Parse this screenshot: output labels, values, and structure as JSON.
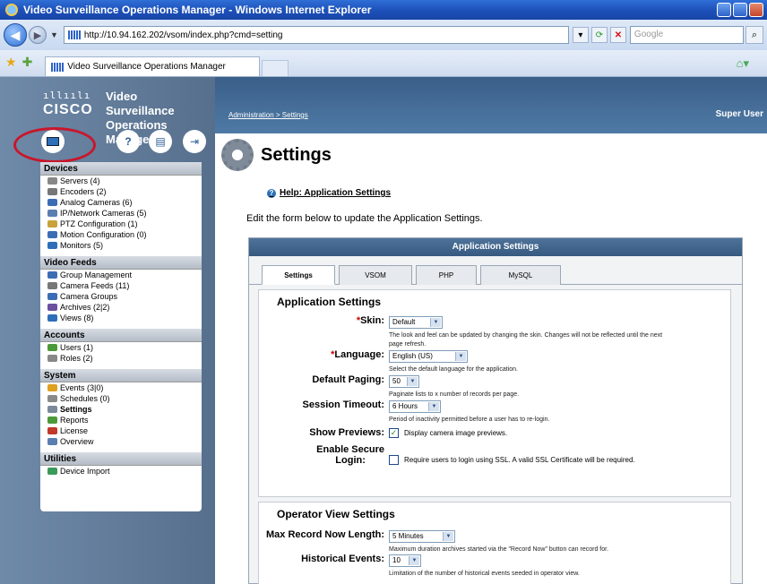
{
  "window": {
    "title": "Video Surveillance Operations Manager - Windows Internet Explorer"
  },
  "browser": {
    "url": "http://10.94.162.202/vsom/index.php?cmd=setting",
    "search_placeholder": "Google",
    "tab_title": "Video Surveillance Operations Manager"
  },
  "brand": {
    "logo_bars": "ıllıılı",
    "logo_word": "CISCO",
    "product_line1": "Video Surveillance",
    "product_line2": "Operations Manager"
  },
  "header": {
    "breadcrumb": "Administration > Settings",
    "user": "Super User"
  },
  "sidebar": {
    "sections": [
      {
        "title": "Devices",
        "items": [
          {
            "label": "Servers (4)",
            "icon": "server-icon",
            "color": "#888888"
          },
          {
            "label": "Encoders (2)",
            "icon": "encoder-icon",
            "color": "#777777"
          },
          {
            "label": "Analog Cameras (6)",
            "icon": "camera-icon",
            "color": "#3b6db5"
          },
          {
            "label": "IP/Network Cameras (5)",
            "icon": "ip-camera-icon",
            "color": "#5a7fb0"
          },
          {
            "label": "PTZ Configuration (1)",
            "icon": "ptz-icon",
            "color": "#caa23a"
          },
          {
            "label": "Motion Configuration (0)",
            "icon": "motion-icon",
            "color": "#3b6db5"
          },
          {
            "label": "Monitors (5)",
            "icon": "monitor-icon",
            "color": "#2d6fb8"
          }
        ]
      },
      {
        "title": "Video Feeds",
        "items": [
          {
            "label": "Group Management",
            "icon": "group-icon",
            "color": "#3b6db5"
          },
          {
            "label": "Camera Feeds (11)",
            "icon": "feeds-icon",
            "color": "#777777"
          },
          {
            "label": "Camera Groups",
            "icon": "camera-groups-icon",
            "color": "#3b6db5"
          },
          {
            "label": "Archives (2|2)",
            "icon": "archive-icon",
            "color": "#6a4ea0"
          },
          {
            "label": "Views (8)",
            "icon": "views-icon",
            "color": "#2d6fb8"
          }
        ]
      },
      {
        "title": "Accounts",
        "items": [
          {
            "label": "Users (1)",
            "icon": "users-icon",
            "color": "#4a9a3a"
          },
          {
            "label": "Roles (2)",
            "icon": "roles-icon",
            "color": "#888888"
          }
        ]
      },
      {
        "title": "System",
        "items": [
          {
            "label": "Events (3|0)",
            "icon": "events-icon",
            "color": "#e0a020"
          },
          {
            "label": "Schedules (0)",
            "icon": "schedules-icon",
            "color": "#8a8a8a"
          },
          {
            "label": "Settings",
            "icon": "settings-icon",
            "color": "#7a8a9a",
            "active": true
          },
          {
            "label": "Reports",
            "icon": "reports-icon",
            "color": "#4a9a3a"
          },
          {
            "label": "License",
            "icon": "license-icon",
            "color": "#c0392b"
          },
          {
            "label": "Overview",
            "icon": "overview-icon",
            "color": "#5a7fb0"
          }
        ]
      },
      {
        "title": "Utilities",
        "items": [
          {
            "label": "Device Import",
            "icon": "import-icon",
            "color": "#3a9a5a"
          }
        ]
      }
    ]
  },
  "page": {
    "title": "Settings",
    "help_link": "Help: Application Settings",
    "intro": "Edit the form below to update the Application Settings."
  },
  "panel": {
    "title": "Application Settings",
    "tabs": [
      "Settings",
      "VSOM",
      "PHP",
      "MySQL"
    ],
    "selected_tab": "Settings",
    "section1_title": "Application Settings",
    "skin_label": "Skin:",
    "skin_value": "Default",
    "skin_hint_1": "The look and feel can be updated by changing the skin. Changes will not be reflected until the next",
    "skin_hint_2": "page refresh.",
    "language_label": "Language:",
    "language_value": "English (US)",
    "language_hint": "Select the default language for the application.",
    "paging_label": "Default Paging:",
    "paging_value": "50",
    "paging_hint": "Paginate lists to x number of records per page.",
    "timeout_label": "Session Timeout:",
    "timeout_value": "6 Hours",
    "timeout_hint": "Period of inactivity permitted before a user has to re-login.",
    "previews_label": "Show Previews:",
    "previews_checked": true,
    "previews_check_text": "Display camera image previews.",
    "secure_label_1": "Enable Secure",
    "secure_label_2": "Login:",
    "secure_checked": false,
    "secure_check_text": "Require users to login using SSL. A valid SSL Certificate will be required.",
    "section2_title": "Operator View Settings",
    "maxrec_label": "Max Record Now Length:",
    "maxrec_value": "5 Minutes",
    "maxrec_hint": "Maximum duration archives started via the \"Record Now\" button can record for.",
    "hist_label": "Historical Events:",
    "hist_value": "10",
    "hist_hint": "Limitation of the number of historical events seeded in operator view."
  }
}
